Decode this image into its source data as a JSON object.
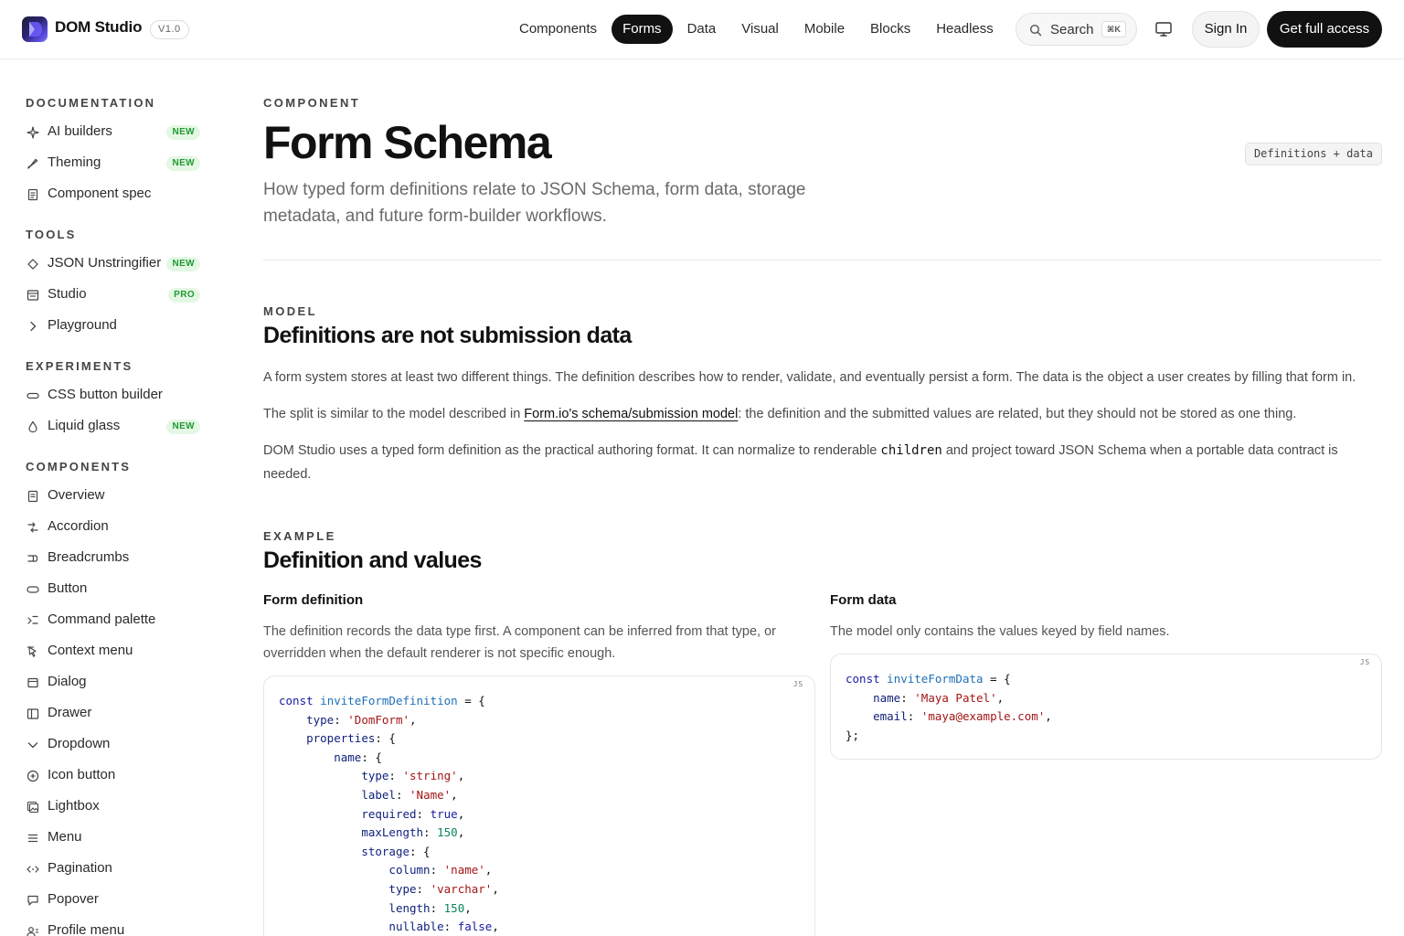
{
  "header": {
    "brand": "DOM Studio",
    "version": "V1.0",
    "nav": [
      {
        "label": "Components",
        "active": false
      },
      {
        "label": "Forms",
        "active": true
      },
      {
        "label": "Data",
        "active": false
      },
      {
        "label": "Visual",
        "active": false
      },
      {
        "label": "Mobile",
        "active": false
      },
      {
        "label": "Blocks",
        "active": false
      },
      {
        "label": "Headless",
        "active": false
      }
    ],
    "search_label": "Search",
    "search_shortcut": "⌘K",
    "signin_label": "Sign In",
    "cta_label": "Get full access"
  },
  "sidebar": {
    "sections": [
      {
        "heading": "DOCUMENTATION",
        "items": [
          {
            "label": "AI builders",
            "icon": "sparkle-icon",
            "badge": "NEW"
          },
          {
            "label": "Theming",
            "icon": "brush-icon",
            "badge": "NEW"
          },
          {
            "label": "Component spec",
            "icon": "document-icon",
            "badge": ""
          }
        ]
      },
      {
        "heading": "TOOLS",
        "items": [
          {
            "label": "JSON Unstringifier",
            "icon": "diamond-icon",
            "badge": "NEW"
          },
          {
            "label": "Studio",
            "icon": "panel-icon",
            "badge": "PRO"
          },
          {
            "label": "Playground",
            "icon": "chevron-right-icon",
            "badge": ""
          }
        ]
      },
      {
        "heading": "EXPERIMENTS",
        "items": [
          {
            "label": "CSS button builder",
            "icon": "pill-icon",
            "badge": ""
          },
          {
            "label": "Liquid glass",
            "icon": "droplet-icon",
            "badge": "NEW"
          }
        ]
      },
      {
        "heading": "COMPONENTS",
        "items": [
          {
            "label": "Overview",
            "icon": "document-icon",
            "badge": ""
          },
          {
            "label": "Accordion",
            "icon": "accordion-icon",
            "badge": ""
          },
          {
            "label": "Breadcrumbs",
            "icon": "breadcrumbs-icon",
            "badge": ""
          },
          {
            "label": "Button",
            "icon": "button-icon",
            "badge": ""
          },
          {
            "label": "Command palette",
            "icon": "command-icon",
            "badge": ""
          },
          {
            "label": "Context menu",
            "icon": "cursor-icon",
            "badge": ""
          },
          {
            "label": "Dialog",
            "icon": "dialog-icon",
            "badge": ""
          },
          {
            "label": "Drawer",
            "icon": "drawer-icon",
            "badge": ""
          },
          {
            "label": "Dropdown",
            "icon": "chevron-down-icon",
            "badge": ""
          },
          {
            "label": "Icon button",
            "icon": "plus-circle-icon",
            "badge": ""
          },
          {
            "label": "Lightbox",
            "icon": "gallery-icon",
            "badge": ""
          },
          {
            "label": "Menu",
            "icon": "menu-icon",
            "badge": ""
          },
          {
            "label": "Pagination",
            "icon": "pagination-icon",
            "badge": ""
          },
          {
            "label": "Popover",
            "icon": "popover-icon",
            "badge": ""
          },
          {
            "label": "Profile menu",
            "icon": "users-icon",
            "badge": ""
          }
        ]
      }
    ]
  },
  "main": {
    "eyebrow": "COMPONENT",
    "title": "Form Schema",
    "tag": "Definitions + data",
    "subtitle": "How typed form definitions relate to JSON Schema, form data, storage metadata, and future form-builder workflows.",
    "model": {
      "eyebrow": "MODEL",
      "heading": "Definitions are not submission data",
      "p1": "A form system stores at least two different things. The definition describes how to render, validate, and eventually persist a form. The data is the object a user creates by filling that form in.",
      "p2_before": "The split is similar to the model described in ",
      "p2_link": "Form.io's schema/submission model",
      "p2_after": ": the definition and the submitted values are related, but they should not be stored as one thing.",
      "p3_before": "DOM Studio uses a typed form definition as the practical authoring format. It can normalize to renderable ",
      "p3_code": "children",
      "p3_after": " and project toward JSON Schema when a portable data contract is needed."
    },
    "example": {
      "eyebrow": "EXAMPLE",
      "heading": "Definition and values",
      "definition": {
        "title": "Form definition",
        "desc": "The definition records the data type first. A component can be inferred from that type, or overridden when the default renderer is not specific enough.",
        "lang": "JS",
        "code": {
          "kw_const": "const",
          "var_name": "inviteFormDefinition",
          "type_val": "'DomForm'",
          "field": "name",
          "field_type": "'string'",
          "field_label": "'Name'",
          "required": "true",
          "max_length": "150",
          "column": "'name'",
          "column_type": "'varchar'",
          "length": "150",
          "nullable": "false"
        }
      },
      "data": {
        "title": "Form data",
        "desc": "The model only contains the values keyed by field names.",
        "lang": "JS",
        "code": {
          "kw_const": "const",
          "var_name": "inviteFormData",
          "name_val": "'Maya Patel'",
          "email_val": "'maya@example.com'"
        }
      }
    }
  }
}
